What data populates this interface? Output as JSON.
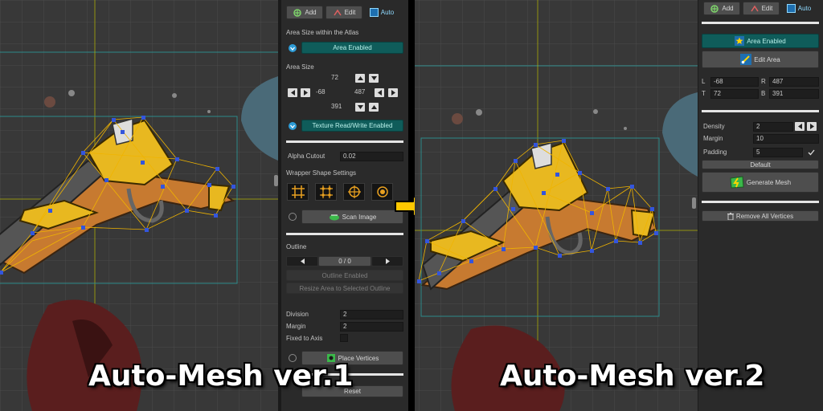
{
  "left_panel": {
    "toolbar": {
      "add": "Add",
      "edit": "Edit",
      "auto": "Auto"
    },
    "area_size_within_atlas": "Area Size within the Atlas",
    "area_enabled": "Area Enabled",
    "area_size": "Area Size",
    "top_value": "72",
    "left_value": "-68",
    "right_value": "487",
    "bottom_value": "391",
    "texture_rw": "Texture Read/Write Enabled",
    "alpha_cutout_label": "Alpha Cutout",
    "alpha_cutout_value": "0.02",
    "wrapper_shape": "Wrapper Shape Settings",
    "scan_image": "Scan Image",
    "outline_label": "Outline",
    "outline_counter": "0 / 0",
    "outline_enabled": "Outline Enabled",
    "resize_area": "Resize Area to Selected Outline",
    "division_label": "Division",
    "division_value": "2",
    "margin_label": "Margin",
    "margin_value": "2",
    "fixed_axis_label": "Fixed to Axis",
    "place_vertices": "Place Vertices",
    "reset": "Reset"
  },
  "right_panel": {
    "toolbar": {
      "add": "Add",
      "edit": "Edit",
      "auto": "Auto"
    },
    "area_enabled": "Area Enabled",
    "edit_area": "Edit Area",
    "l_label": "L",
    "l_value": "-68",
    "r_label": "R",
    "r_value": "487",
    "t_label": "T",
    "t_value": "72",
    "b_label": "B",
    "b_value": "391",
    "density_label": "Density",
    "density_value": "2",
    "margin_label": "Margin",
    "margin_value": "10",
    "padding_label": "Padding",
    "padding_value": "5",
    "default": "Default",
    "generate_mesh": "Generate Mesh",
    "remove_all": "Remove All Vertices"
  },
  "captions": {
    "left": "Auto-Mesh ver.1",
    "right": "Auto-Mesh ver.2"
  },
  "colors": {
    "teal_button": "#0f5c5a",
    "accent_blue": "#8fd9ff",
    "mesh_line": "#f0b400",
    "vertex": "#3355dd",
    "arrow": "#ffc800"
  }
}
